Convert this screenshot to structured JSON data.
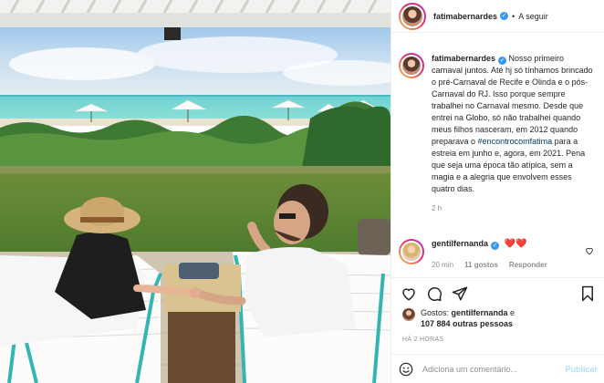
{
  "post": {
    "author": "fatimabernardes",
    "follow_label": "A seguir",
    "separator": "•",
    "caption_text": "Nosso primeiro carnaval juntos. Até hj só tínhamos brincado o pré-Carnaval de Recife e Olinda e o pós-Carnaval do RJ. Isso porque sempre trabalhei no Carnaval mesmo. Desde que entrei na Globo, só não trabalhei quando meus filhos nasceram, em 2012 quando preparava o ",
    "caption_hashtag": "#encontrocomfatima",
    "caption_text_end": " para a estreia em junho e, agora, em 2021. Pena que seja uma época tão atípica, sem a magia e a alegria que envolvem esses quatro dias.",
    "caption_time": "2 h"
  },
  "reply": {
    "author": "gentilfernanda",
    "emoji": "❤️❤️",
    "time": "20 min",
    "likes": "11 gostos",
    "reply_label": "Responder"
  },
  "likes": {
    "prefix": "Gostos: ",
    "first_user": "gentilfernanda",
    "connector": " e",
    "others": "107 884 outras pessoas"
  },
  "timestamp": "HÁ 2 HORAS",
  "comment_box": {
    "placeholder": "Adiciona um comentário...",
    "publish_label": "Publicar"
  },
  "icons": {
    "verified": "verified-badge-icon",
    "like": "heart-icon",
    "comment": "comment-icon",
    "share": "paper-plane-icon",
    "save": "bookmark-icon",
    "emoji": "emoji-icon"
  },
  "colors": {
    "link": "#00376b",
    "verified": "#3897f0",
    "hearts": "#ed4956",
    "publish_disabled": "#b2dffc",
    "muted": "#8e8e8e"
  }
}
